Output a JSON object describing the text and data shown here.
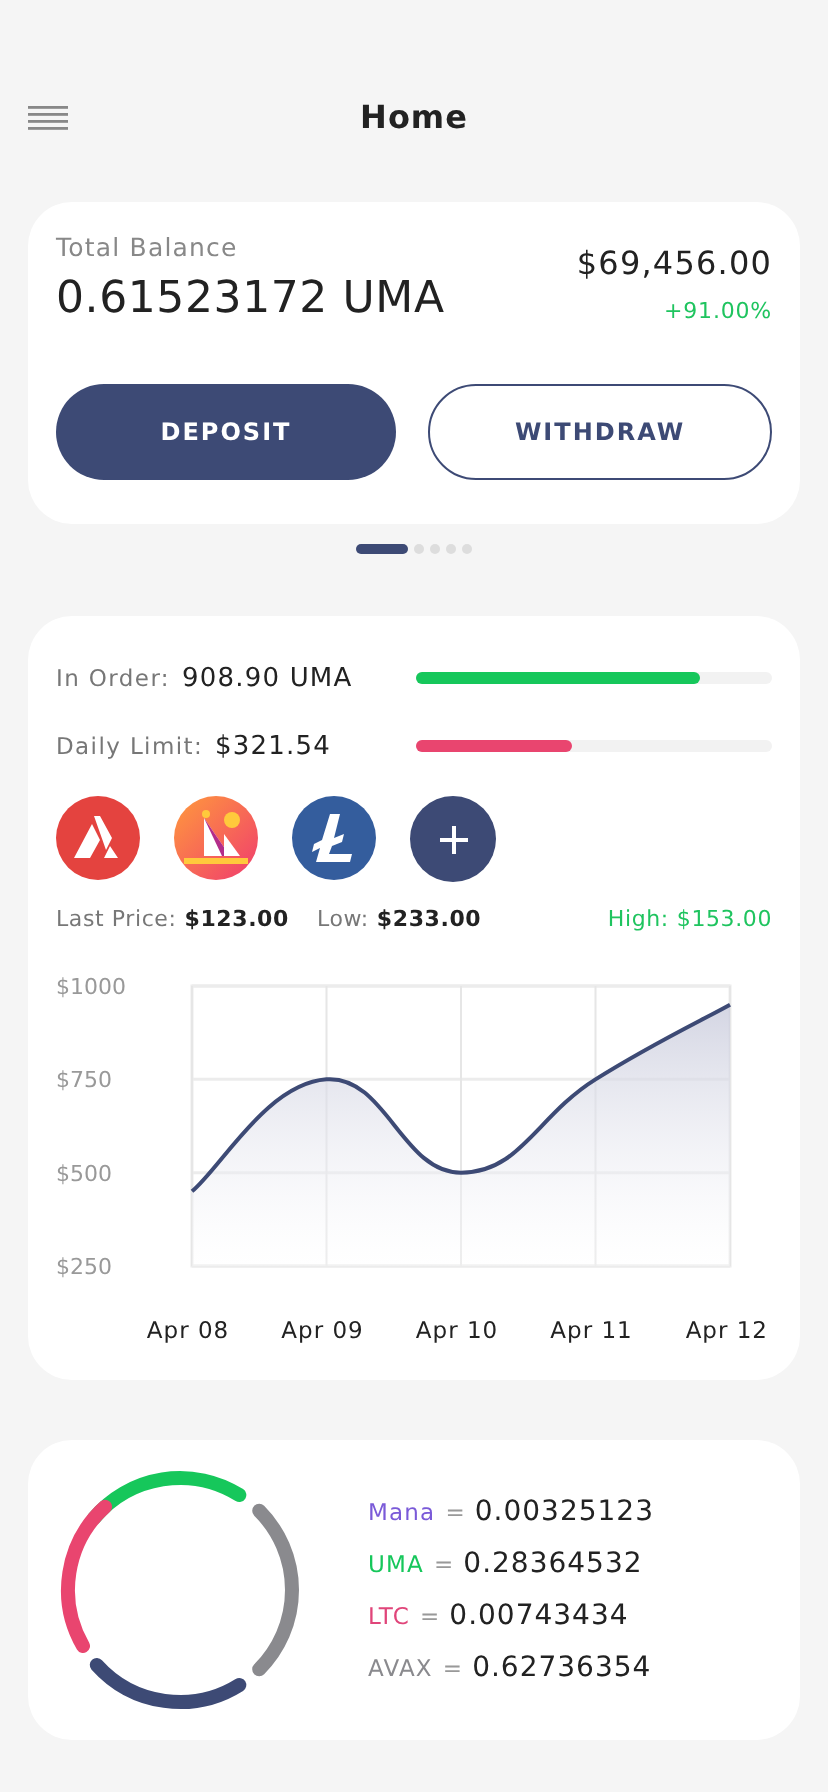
{
  "header": {
    "title": "Home"
  },
  "balance": {
    "label": "Total Balance",
    "amount": "0.61523172 UMA",
    "fiat": "$69,456.00",
    "change": "+91.00%"
  },
  "buttons": [
    {
      "label": "DEPOSIT",
      "kind": "primary"
    },
    {
      "label": "WITHDRAW",
      "kind": "outline"
    }
  ],
  "pager": [
    {
      "selected": true
    },
    {
      "selected": false
    },
    {
      "selected": false
    },
    {
      "selected": false
    },
    {
      "selected": false
    }
  ],
  "limits": [
    {
      "label": "In Order:",
      "value": "908.90 UMA",
      "level": 0.8,
      "color": "#16c75b"
    },
    {
      "label": "Daily Limit:",
      "value": "$321.54",
      "level": 0.44,
      "color": "#e9456f"
    }
  ],
  "stats": [
    {
      "label": "Last Price:",
      "value": "$123.00",
      "kind": "plain"
    },
    {
      "label": "Low:",
      "value": "$233.00",
      "kind": "plain"
    },
    {
      "label": "High:",
      "value": "$153.00",
      "kind": "positive"
    }
  ],
  "chart_data": {
    "type": "area",
    "categories": [
      "Apr 08",
      "Apr 09",
      "Apr 10",
      "Apr 11",
      "Apr 12"
    ],
    "series": [
      {
        "color": "#3d4a75",
        "values": [
          450,
          750,
          500,
          750,
          950
        ]
      }
    ],
    "ylim": [
      250,
      1000
    ],
    "grid": true,
    "yticks": [
      {
        "value": 1000,
        "label": "$1000"
      },
      {
        "value": 750,
        "label": "$750"
      },
      {
        "value": 500,
        "label": "$500"
      },
      {
        "value": 250,
        "label": "$250"
      }
    ]
  },
  "holdings": [
    {
      "label": "Mana",
      "sep": "=",
      "value": "0.00325123",
      "color": "#7a5ad8"
    },
    {
      "label": "UMA",
      "sep": "=",
      "value": "0.28364532",
      "color": "#16c75b"
    },
    {
      "label": "LTC",
      "sep": "=",
      "value": "0.00743434",
      "color": "#e0457a"
    },
    {
      "label": "AVAX",
      "sep": "=",
      "value": "0.62736354",
      "color": "#8a8a8e"
    }
  ]
}
